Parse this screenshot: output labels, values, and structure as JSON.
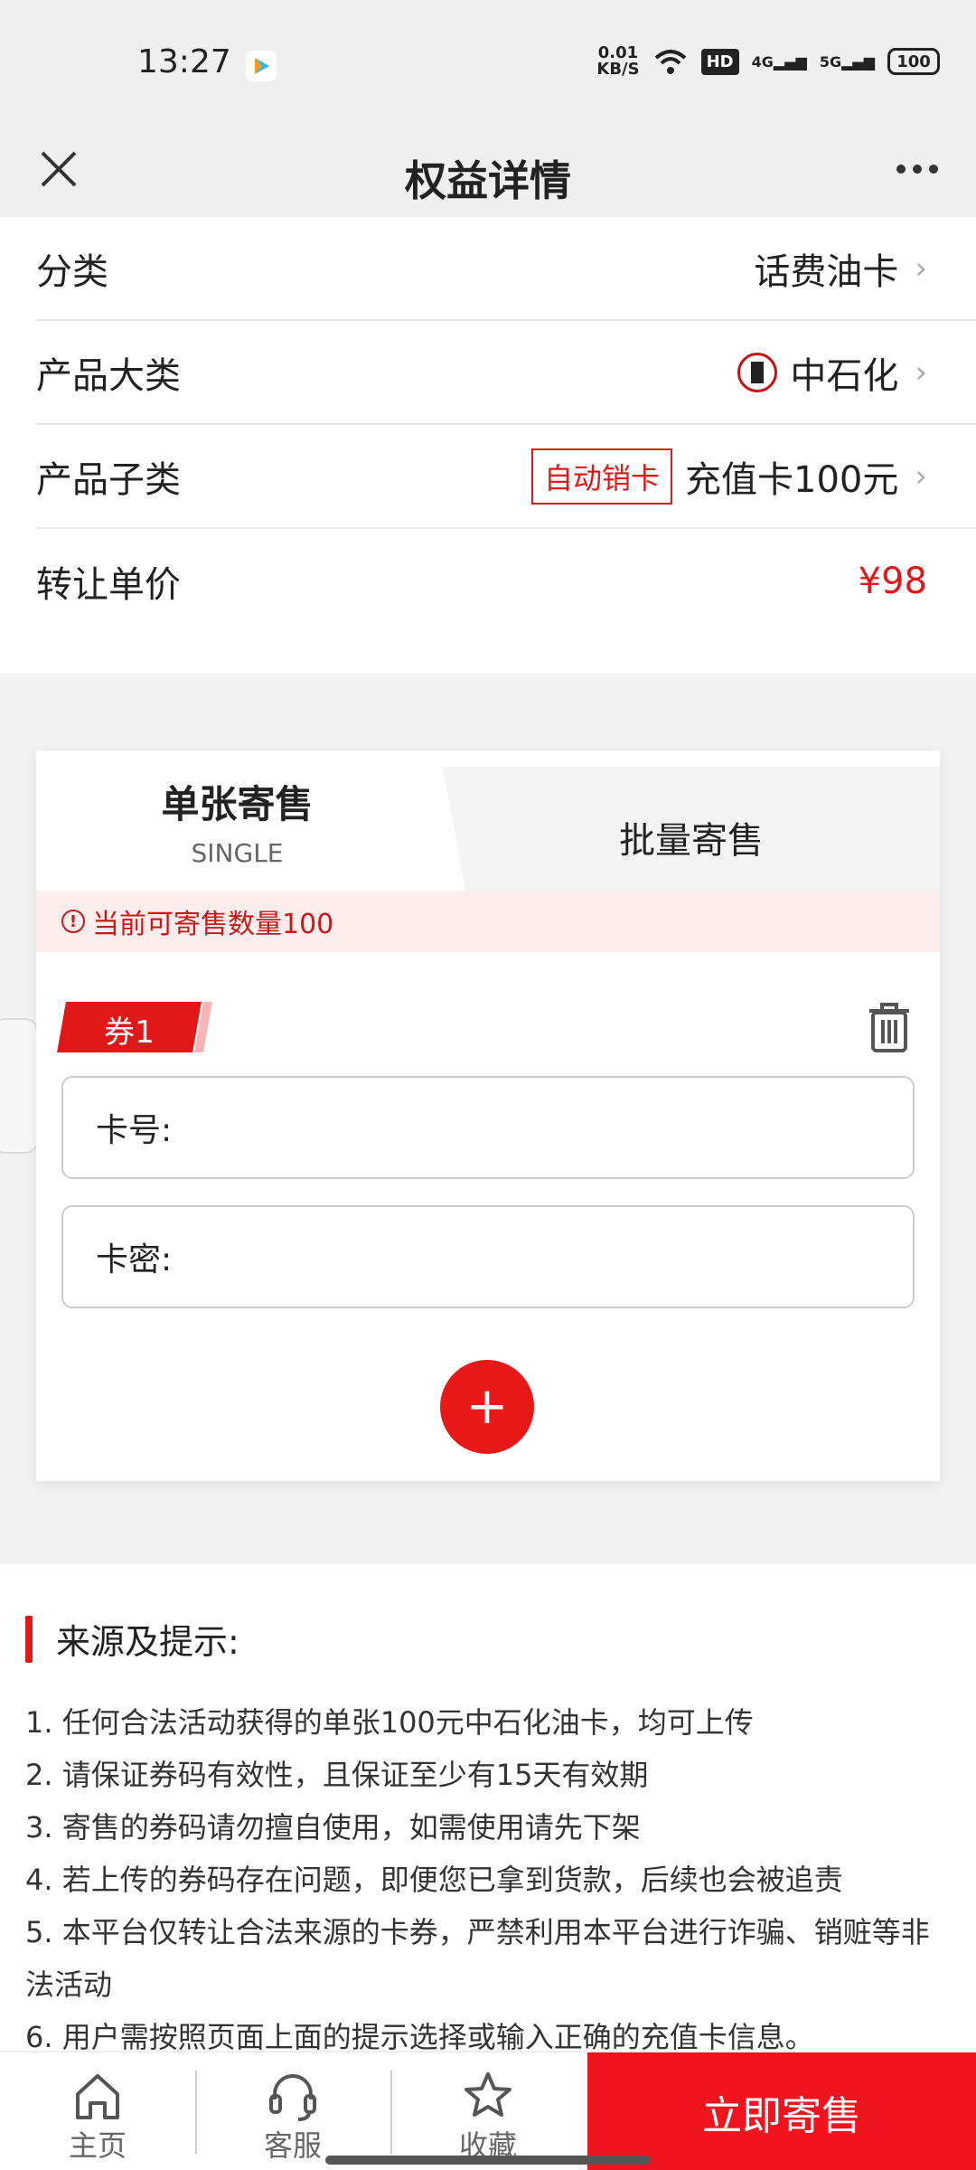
{
  "status": {
    "time": "13:27",
    "net_speed_top": "0.01",
    "net_speed_bottom": "KB/S",
    "hd": "HD",
    "sig1": "4G",
    "sig2": "5G",
    "battery": "100"
  },
  "nav": {
    "title": "权益详情"
  },
  "info": {
    "category_label": "分类",
    "category_value": "话费油卡",
    "product_label": "产品大类",
    "product_value": "中石化",
    "sub_label": "产品子类",
    "sub_badge": "自动销卡",
    "sub_value": "充值卡100元",
    "price_label": "转让单价",
    "price_value": "¥98"
  },
  "sell": {
    "tab_single": "单张寄售",
    "tab_single_sub": "SINGLE",
    "tab_batch": "批量寄售",
    "notice": "当前可寄售数量100",
    "coupon_tag": "券1",
    "card_no_label": "卡号:",
    "card_pwd_label": "卡密:",
    "add_symbol": "+"
  },
  "tips": {
    "title": "来源及提示:",
    "items": [
      "1. 任何合法活动获得的单张100元中石化油卡，均可上传",
      "2. 请保证券码有效性，且保证至少有15天有效期",
      "3. 寄售的券码请勿擅自使用，如需使用请先下架",
      "4. 若上传的券码存在问题，即便您已拿到货款，后续也会被追责",
      "5. 本平台仅转让合法来源的卡券，严禁利用本平台进行诈骗、销赃等非法活动",
      "6. 用户需按照页面上面的提示选择或输入正确的充值卡信息。"
    ]
  },
  "tabbar": {
    "home": "主页",
    "service": "客服",
    "favorite": "收藏",
    "sell_now": "立即寄售"
  },
  "colors": {
    "accent": "#e01818",
    "sell_button": "#f0141e"
  }
}
